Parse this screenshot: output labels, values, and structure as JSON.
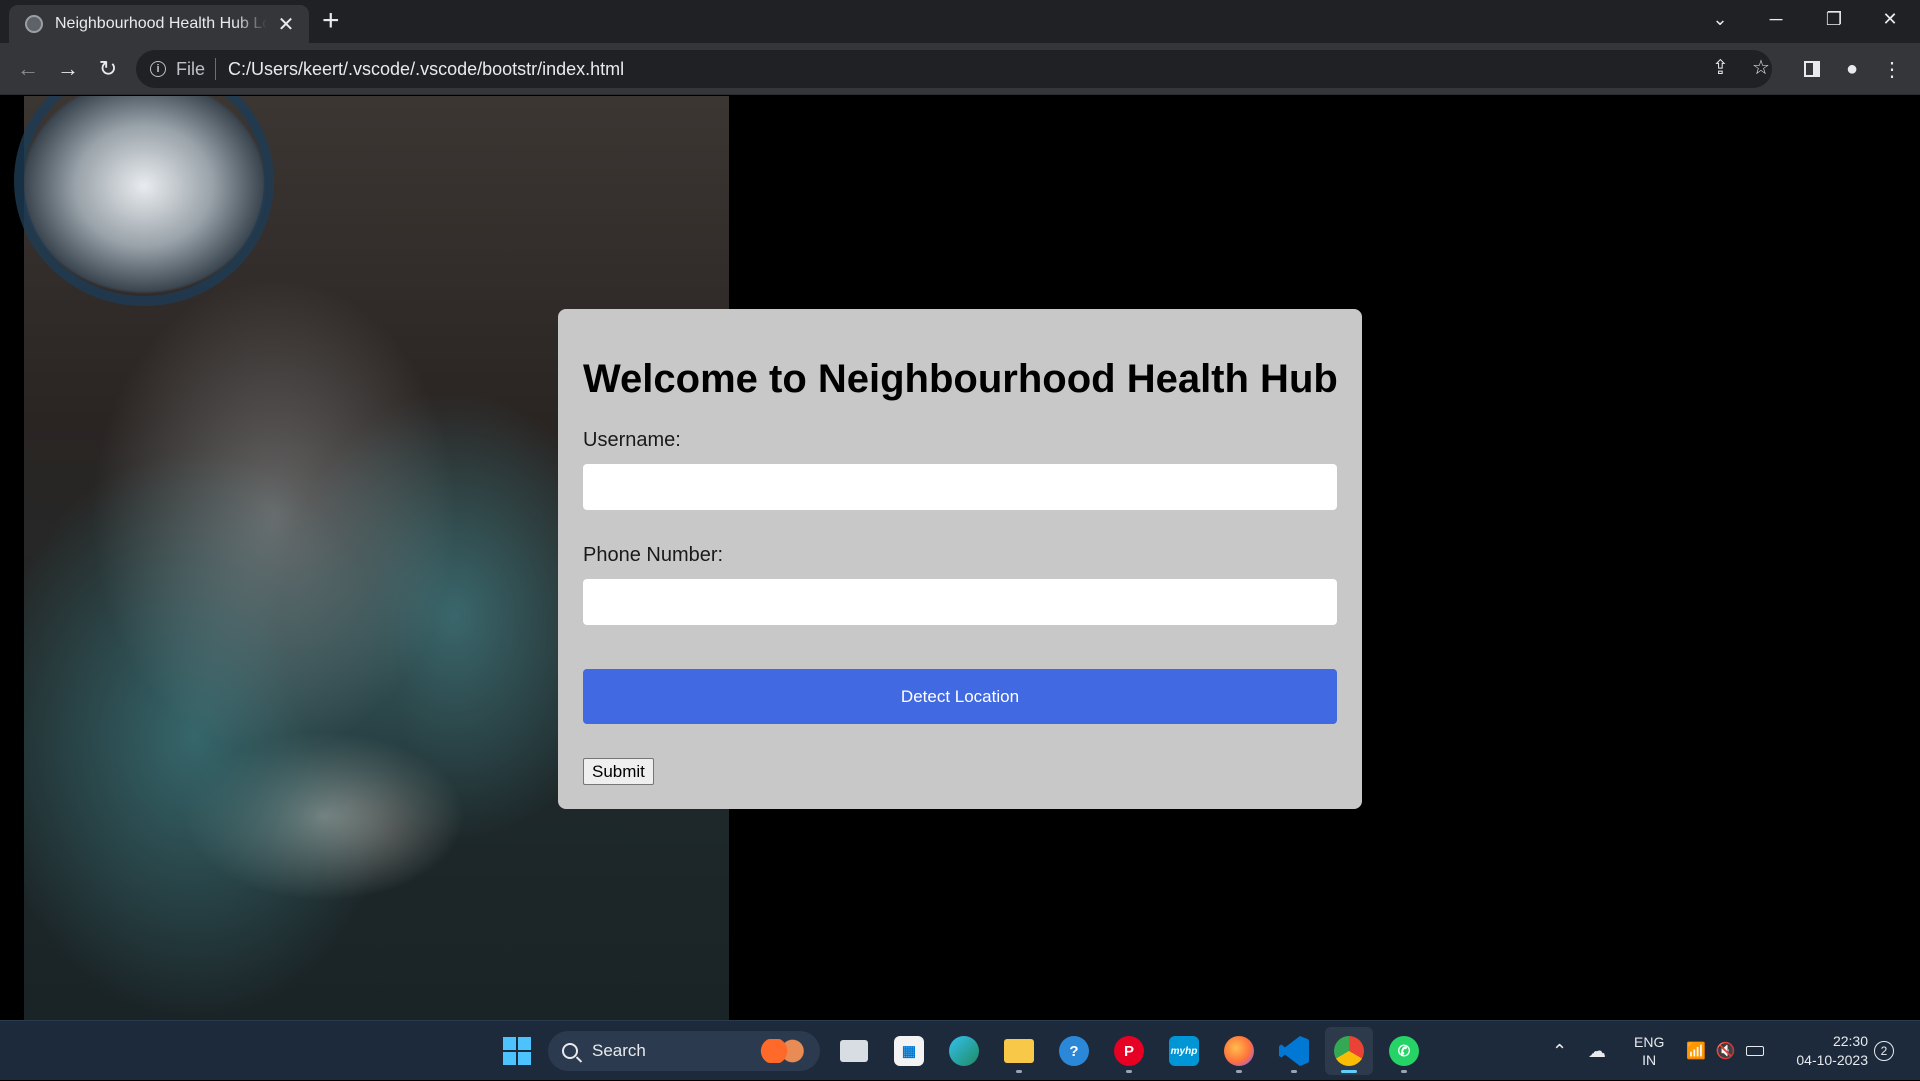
{
  "browser": {
    "tab_title": "Neighbourhood Health Hub Login",
    "tab_close": "✕",
    "new_tab": "+",
    "url_scheme": "File",
    "url": "C:/Users/keert/.vscode/.vscode/bootstr/index.html",
    "window_controls": {
      "tabsearch": "⌄",
      "minimize": "─",
      "restore": "❐",
      "close": "✕"
    }
  },
  "page": {
    "heading": "Welcome to Neighbourhood Health Hub",
    "username_label": "Username:",
    "username_value": "",
    "phone_label": "Phone Number:",
    "phone_value": "",
    "detect_button": "Detect Location",
    "submit_button": "Submit",
    "accent_color": "#4169e1",
    "card_color": "#c8c8c8"
  },
  "taskbar": {
    "search_label": "Search",
    "apps": [
      "file-explorer",
      "microsoft-store",
      "edge",
      "folder",
      "help",
      "pinterest",
      "myhp",
      "firefox",
      "vscode",
      "chrome",
      "whatsapp"
    ],
    "lang_line1": "ENG",
    "lang_line2": "IN",
    "time": "22:30",
    "date": "04-10-2023",
    "notification_count": "2"
  }
}
